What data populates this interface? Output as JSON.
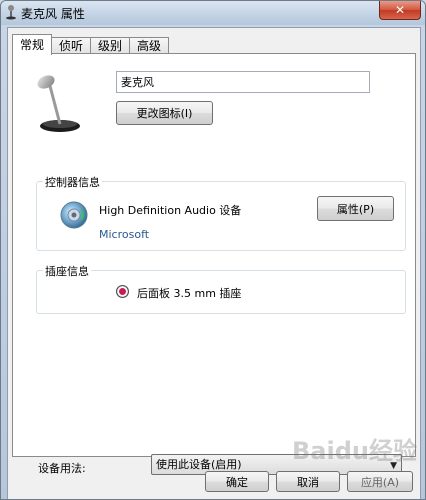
{
  "window": {
    "title": "麦克风 属性",
    "close_glyph": "✕"
  },
  "tabs": [
    {
      "label": "常规",
      "active": true
    },
    {
      "label": "侦听",
      "active": false
    },
    {
      "label": "级别",
      "active": false
    },
    {
      "label": "高级",
      "active": false
    }
  ],
  "general": {
    "name_value": "麦克风",
    "change_icon_label": "更改图标(I)",
    "controller": {
      "group_label": "控制器信息",
      "device_name": "High Definition Audio 设备",
      "vendor": "Microsoft",
      "properties_label": "属性(P)"
    },
    "jack": {
      "group_label": "插座信息",
      "jack_label": "后面板 3.5 mm 插座",
      "jack_color": "#c81b5a"
    },
    "device_usage": {
      "label": "设备用法:",
      "selected": "使用此设备(启用)"
    }
  },
  "footer": {
    "ok_label": "确定",
    "cancel_label": "取消",
    "apply_label": "应用(A)"
  },
  "watermark": "Baidu经验",
  "icons": {
    "title": "microphone-icon",
    "device": "microphone-icon",
    "controller": "speaker-icon",
    "jack": "jack-dot-icon",
    "dropdown": "chevron-down-icon"
  }
}
